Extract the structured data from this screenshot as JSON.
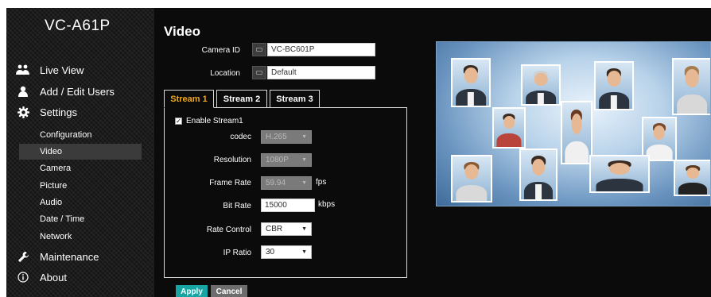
{
  "sidebar": {
    "model": "VC-A61P",
    "nav": {
      "live_view": "Live View",
      "users": "Add / Edit Users",
      "settings": "Settings",
      "maintenance": "Maintenance",
      "about": "About"
    },
    "settings_items": [
      "Configuration",
      "Video",
      "Camera",
      "Picture",
      "Audio",
      "Date / Time",
      "Network"
    ],
    "active_item": "Video"
  },
  "main": {
    "title": "Video",
    "camera_id": {
      "label": "Camera ID",
      "value": "VC-BC601P"
    },
    "location": {
      "label": "Location",
      "value": "Default"
    },
    "tabs": [
      "Stream 1",
      "Stream 2",
      "Stream 3"
    ],
    "active_tab": "Stream 1",
    "stream": {
      "enable_label": "Enable Stream1",
      "enabled": true,
      "codec": {
        "label": "codec",
        "value": "H.265",
        "disabled": true
      },
      "resolution": {
        "label": "Resolution",
        "value": "1080P",
        "disabled": true
      },
      "frame_rate": {
        "label": "Frame Rate",
        "value": "59.94",
        "unit": "fps",
        "disabled": true
      },
      "bit_rate": {
        "label": "Bit Rate",
        "value": "15000",
        "unit": "kbps"
      },
      "rate_control": {
        "label": "Rate Control",
        "value": "CBR"
      },
      "ip_ratio": {
        "label": "IP Ratio",
        "value": "30"
      }
    },
    "apply_label": "Apply",
    "cancel_label": "Cancel"
  },
  "colors": {
    "background": "#0b0b0b",
    "active_tab_text": "#f0a71b",
    "apply_button": "#17a5a3",
    "cancel_button": "#6d6d6d"
  },
  "icons": {
    "live_view": "people-icon",
    "users": "user-icon",
    "settings": "gear-icon",
    "maintenance": "wrench-icon",
    "about": "info-icon"
  }
}
